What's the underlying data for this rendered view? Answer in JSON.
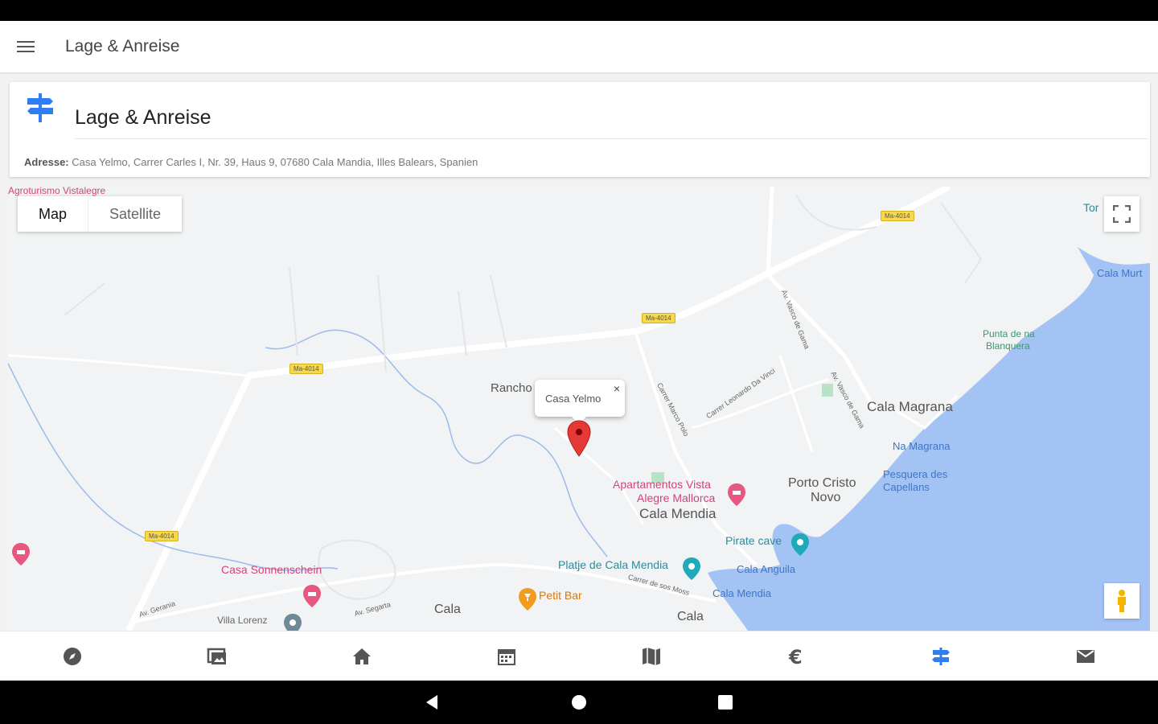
{
  "app_bar": {
    "title": "Lage & Anreise",
    "menu_icon": "hamburger-menu-icon"
  },
  "card": {
    "icon": "signpost-icon",
    "title": "Lage & Anreise",
    "address_label": "Adresse:",
    "address_value": "Casa Yelmo, Carrer Carles I, Nr. 39, Haus 9, 07680 Cala Mandia, Illes Balears, Spanien"
  },
  "map": {
    "type_map_label": "Map",
    "type_satellite_label": "Satellite",
    "info_window_text": "Casa Yelmo",
    "info_close": "×",
    "labels": {
      "rancho": "Rancho",
      "cala_magrana": "Cala Magrana",
      "na_magrana": "Na Magrana",
      "pesquera_1": "Pesquera des",
      "pesquera_2": "Capellans",
      "porto_cristo_1": "Porto Cristo",
      "porto_cristo_2": "Novo",
      "cala_mendia": "Cala Mendia",
      "apartamentos_1": "Apartamentos Vista",
      "apartamentos_2": "Alegre Mallorca",
      "pirate_cave": "Pirate cave",
      "platje": "Platje de Cala Mendia",
      "cala_anguila": "Cala Anguila",
      "cala_mendia_2": "Cala Mendia",
      "petit_bar": "Petit Bar",
      "casa_sonnenschein": "Casa Sonnenschein",
      "cala_domingos": "Cala",
      "cala_bottom": "Cala",
      "cala_murta": "Cala Murt",
      "punta": "Punta de na",
      "punta_2": "Blanquera",
      "top_right": "Tor",
      "top_left_poi": "Agroturismo Vistalegre",
      "villa": "Villa Lorenz",
      "street_marco_polo": "Carrer Marco Polo",
      "street_leonardo": "Carrer Leonardo Da Vinci",
      "street_vasco": "Av. Vasco de Gama",
      "street_vasco_2": "Av. Vasco de Gama",
      "street_cala_mendia": "Carrer de sos Moss",
      "street_s1": "Av. Gerania",
      "street_s2": "Av. Segarta"
    },
    "road_shields": [
      "Ma-4014",
      "Ma-4014",
      "Ma-4014",
      "Ma-4014"
    ]
  },
  "bottom_nav": [
    {
      "icon": "compass-icon",
      "active": false
    },
    {
      "icon": "photo-gallery-icon",
      "active": false
    },
    {
      "icon": "home-icon",
      "active": false
    },
    {
      "icon": "calendar-icon",
      "active": false
    },
    {
      "icon": "map-icon",
      "active": false
    },
    {
      "icon": "euro-icon",
      "active": false
    },
    {
      "icon": "signpost-icon",
      "active": true
    },
    {
      "icon": "mail-icon",
      "active": false
    }
  ],
  "colors": {
    "accent": "#2f7df5",
    "water": "#a4c3f5",
    "marker": "#e53935",
    "nav_icon": "#555555"
  }
}
